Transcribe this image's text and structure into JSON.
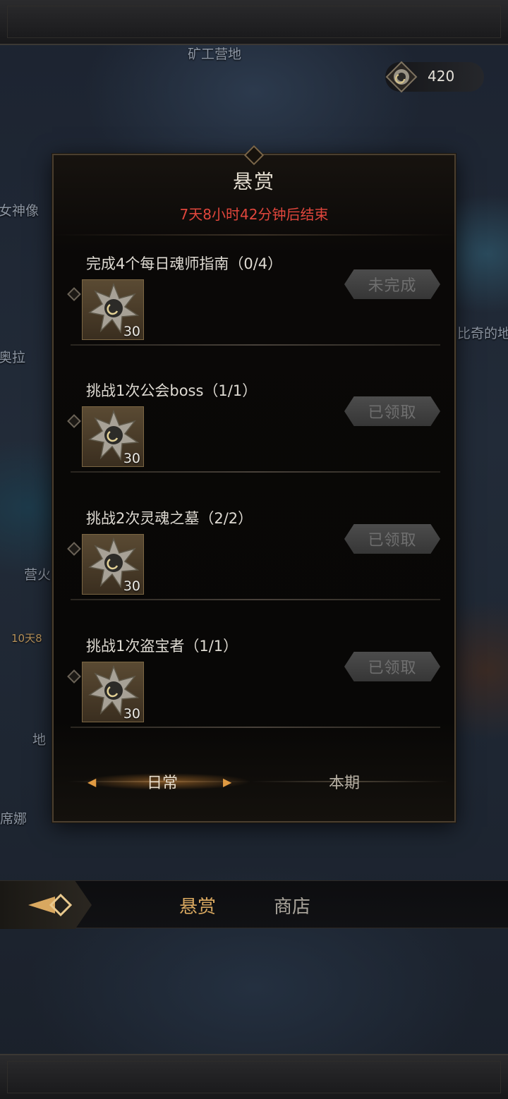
{
  "map": {
    "labels": [
      "矿工营地",
      "女神像",
      "奥拉",
      "营火",
      "比奇的地",
      "地",
      "席娜"
    ],
    "timer_fragment": "10天8"
  },
  "currency": {
    "icon": "soul-emblem-icon",
    "value": "420"
  },
  "panel": {
    "title": "悬赏",
    "timer": "7天8小时42分钟后结束",
    "colors": {
      "timer": "#e0463c",
      "accent": "#d9a860"
    }
  },
  "tasks": [
    {
      "name": "完成4个每日魂师指南（0/4）",
      "reward_count": "30",
      "status": "未完成"
    },
    {
      "name": "挑战1次公会boss（1/1）",
      "reward_count": "30",
      "status": "已领取"
    },
    {
      "name": "挑战2次灵魂之墓（2/2）",
      "reward_count": "30",
      "status": "已领取"
    },
    {
      "name": "挑战1次盗宝者（1/1）",
      "reward_count": "30",
      "status": "已领取"
    }
  ],
  "tabs": {
    "daily": "日常",
    "period": "本期"
  },
  "bottom_nav": {
    "bounty": "悬赏",
    "shop": "商店"
  }
}
